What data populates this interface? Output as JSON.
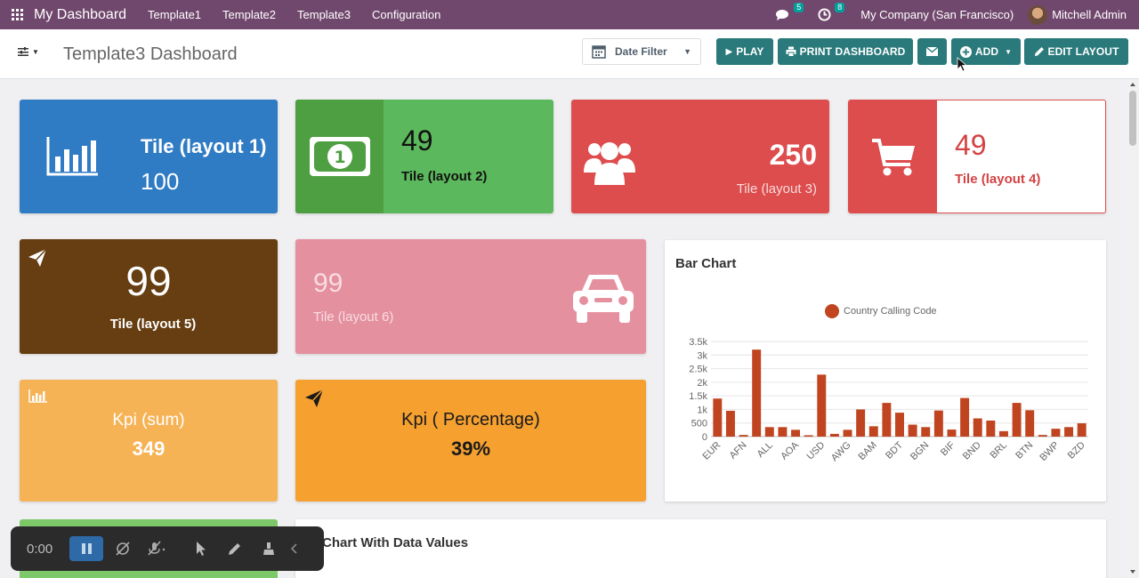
{
  "nav": {
    "brand": "My Dashboard",
    "menu": [
      "Template1",
      "Template2",
      "Template3",
      "Configuration"
    ],
    "messages_badge": "5",
    "activity_badge": "8",
    "company": "My Company (San Francisco)",
    "user": "Mitchell Admin"
  },
  "controls": {
    "page_title": "Template3 Dashboard",
    "date_filter": "Date Filter",
    "play": "PLAY",
    "print": "PRINT DASHBOARD",
    "add": "ADD",
    "edit_layout": "EDIT LAYOUT"
  },
  "tiles": {
    "t1": {
      "name": "Tile (layout 1)",
      "value": "100",
      "color": "#2f7bc4"
    },
    "t2": {
      "name": "Tile (layout 2)",
      "value": "49",
      "color": "#5cb85c"
    },
    "t3": {
      "name": "Tile (layout 3)",
      "value": "250",
      "color": "#de4d4d"
    },
    "t4": {
      "name": "Tile (layout 4)",
      "value": "49",
      "color": "#de4d4d"
    },
    "t5": {
      "name": "Tile (layout 5)",
      "value": "99",
      "color": "#663e12"
    },
    "t6": {
      "name": "Tile (layout 6)",
      "value": "99",
      "color": "#e5909f"
    }
  },
  "kpis": {
    "k1": {
      "name": "Kpi (sum)",
      "value": "349"
    },
    "k2": {
      "name": "Kpi ( Percentage)",
      "value": "39%"
    }
  },
  "bar_chart_title": "Bar Chart",
  "second_chart_title": "r Chart With Data Values",
  "recorder": {
    "time": "0:00"
  },
  "chart_data": {
    "type": "bar",
    "title": "Bar Chart",
    "series": [
      {
        "name": "Country Calling Code",
        "color": "#c0441f",
        "values": [
          1400,
          950,
          60,
          3200,
          350,
          350,
          250,
          50,
          2280,
          100,
          250,
          1000,
          380,
          1240,
          880,
          440,
          350,
          960,
          260,
          1420,
          670,
          590,
          200,
          1240,
          970,
          60,
          290,
          350,
          490
        ]
      }
    ],
    "categories": [
      "EUR",
      "",
      "AFN",
      "",
      "ALL",
      "",
      "AOA",
      "",
      "USD",
      "",
      "AWG",
      "",
      "BAM",
      "",
      "BDT",
      "",
      "BGN",
      "",
      "BIF",
      "",
      "BND",
      "",
      "BRL",
      "",
      "BTN",
      "",
      "BWP",
      "",
      "BZD"
    ],
    "ylim": [
      0,
      3500
    ],
    "yticks": [
      "0",
      "500",
      "1k",
      "1.5k",
      "2k",
      "2.5k",
      "3k",
      "3.5k"
    ],
    "legend": "top"
  }
}
